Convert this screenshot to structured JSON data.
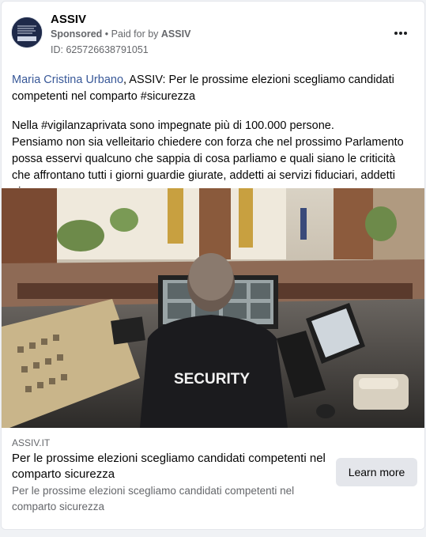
{
  "post": {
    "page_name": "ASSIV",
    "sponsored_label": "Sponsored",
    "separator": "•",
    "paid_for_prefix": "Paid for by",
    "paid_for_by": "ASSIV",
    "ad_id": "ID: 625726638791051",
    "more_icon": "more-horizontal-icon"
  },
  "body": {
    "mention": "Maria Cristina Urbano",
    "line1_rest": ", ASSIV: Per le prossime elezioni scegliamo candidati competenti nel comparto #sicurezza",
    "paragraph2": "Nella #vigilanzaprivata sono impegnate più di 100.000 persone.",
    "paragraph3": "Pensiamo non sia velleitario chiedere con forza che nel prossimo Parlamento possa esservi qualcuno che sappia di cosa parliamo e quali siano le criticità che affrontano tutti i giorni guardie giurate, addetti ai servizi fiduciari, addetti ai..."
  },
  "image": {
    "shirt_text": "SECURITY"
  },
  "link": {
    "domain": "ASSIV.IT",
    "title": "Per le prossime elezioni scegliamo candidati competenti nel comparto sicurezza",
    "description": "Per le prossime elezioni scegliamo candidati competenti nel comparto sicurezza",
    "cta": "Learn more"
  },
  "colors": {
    "link_blue": "#385898",
    "secondary_text": "#65676b",
    "button_bg": "#e4e6eb"
  }
}
